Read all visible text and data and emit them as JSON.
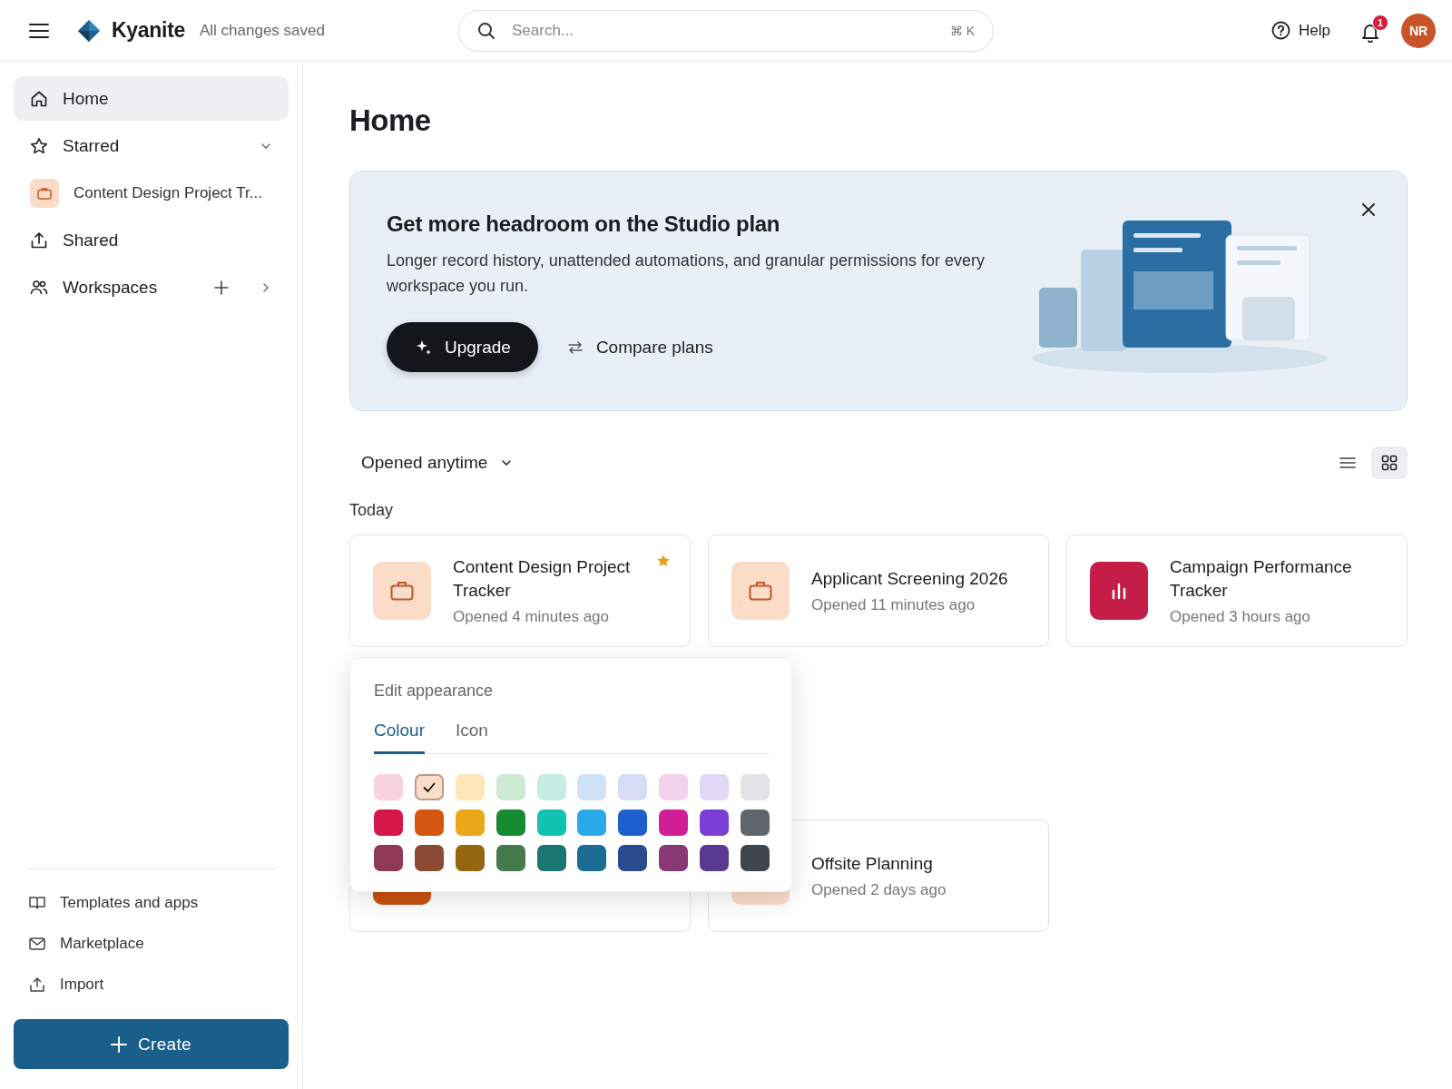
{
  "topbar": {
    "app_name": "Kyanite",
    "save_status": "All changes saved",
    "search": {
      "placeholder": "Search...",
      "shortcut": "⌘ K"
    },
    "help": "Help",
    "notifications": "1",
    "avatar": "NR"
  },
  "sidebar": {
    "items": [
      {
        "kind": "home",
        "label": "Home",
        "selected": true
      },
      {
        "kind": "starred",
        "label": "Starred",
        "selected": false
      },
      {
        "kind": "project",
        "label": "Content Design Project Tr...",
        "selected": false,
        "color": "#fbdcc8"
      },
      {
        "kind": "shared",
        "label": "Shared",
        "selected": false
      },
      {
        "kind": "workspaces",
        "label": "Workspaces",
        "selected": false
      }
    ],
    "footer_items": [
      {
        "kind": "book",
        "label": "Templates and apps"
      },
      {
        "kind": "mail",
        "label": "Marketplace"
      },
      {
        "kind": "upload",
        "label": "Import"
      }
    ],
    "create_button": "Create"
  },
  "page_title": "Home",
  "banner": {
    "title": "Get more headroom on the Studio plan",
    "body": "Longer record history, unattended automations, and granular permissions for every workspace you run.",
    "primary_button": "Upgrade",
    "secondary_button": "Compare plans"
  },
  "filter": {
    "label": "Opened anytime"
  },
  "view_toggles": [
    {
      "kind": "list",
      "selected": false
    },
    {
      "kind": "grid",
      "selected": true
    }
  ],
  "sections": [
    {
      "heading": "Today",
      "cards": [
        {
          "title": "Content Design Project Tracker",
          "subtitle": "Opened 4 minutes ago",
          "kind": "briefcase",
          "color": "#fbdcc8",
          "starred": true
        },
        {
          "title": "Applicant Screening 2026",
          "subtitle": "Opened 11 minutes ago",
          "kind": "briefcase",
          "color": "#fbdcc8",
          "starred": false
        },
        {
          "title": "Campaign Performance Tracker",
          "subtitle": "Opened 3 hours ago",
          "kind": "chart",
          "color": "#c41e48",
          "starred": false
        }
      ]
    },
    {
      "cards": [
        {
          "kind": "plain",
          "color": "#c9500f"
        },
        {
          "title": "Offsite Planning",
          "subtitle": "Opened 2 days ago",
          "kind": "plain",
          "color": "#fbdcc8",
          "starred": false
        }
      ]
    }
  ],
  "appearance_popup": {
    "title": "Edit appearance",
    "tabs": [
      {
        "label": "Colour",
        "selected": true
      },
      {
        "label": "Icon",
        "selected": false
      }
    ],
    "swatches": [
      {
        "color": "#f8d3de",
        "selected": false
      },
      {
        "color": "#fbdcc8",
        "selected": true
      },
      {
        "color": "#fde6b8",
        "selected": false
      },
      {
        "color": "#cdebd3",
        "selected": false
      },
      {
        "color": "#c6ece6",
        "selected": false
      },
      {
        "color": "#cfe2f8",
        "selected": false
      },
      {
        "color": "#d6dbf6",
        "selected": false
      },
      {
        "color": "#f3d3ec",
        "selected": false
      },
      {
        "color": "#e0d8f6",
        "selected": false
      },
      {
        "color": "#e1e3e6",
        "selected": false
      },
      {
        "color": "#d6174a",
        "selected": false
      },
      {
        "color": "#d4570f",
        "selected": false
      },
      {
        "color": "#e8a817",
        "selected": false
      },
      {
        "color": "#178a33",
        "selected": false
      },
      {
        "color": "#12c2b0",
        "selected": false
      },
      {
        "color": "#2ba8e8",
        "selected": false
      },
      {
        "color": "#1e5fce",
        "selected": false
      },
      {
        "color": "#d21e96",
        "selected": false
      },
      {
        "color": "#7b3fd6",
        "selected": false
      },
      {
        "color": "#5f666d",
        "selected": false
      },
      {
        "color": "#8f3a57",
        "selected": false
      },
      {
        "color": "#8c4a33",
        "selected": false
      },
      {
        "color": "#946610",
        "selected": false
      },
      {
        "color": "#457a4d",
        "selected": false
      },
      {
        "color": "#1b7570",
        "selected": false
      },
      {
        "color": "#1b6b94",
        "selected": false
      },
      {
        "color": "#2b4b8f",
        "selected": false
      },
      {
        "color": "#883872",
        "selected": false
      },
      {
        "color": "#5a3a91",
        "selected": false
      },
      {
        "color": "#3f464e",
        "selected": false
      }
    ]
  }
}
